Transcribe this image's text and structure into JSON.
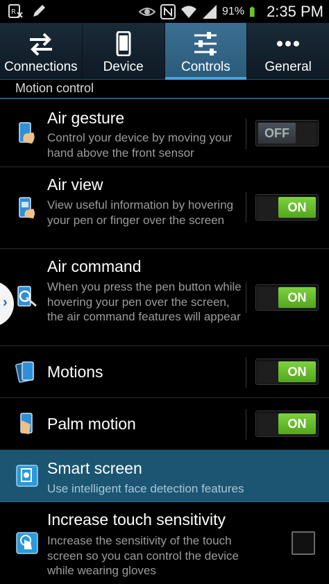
{
  "status_bar": {
    "battery_percent": "91%",
    "time": "2:35 PM",
    "left_icons": [
      "sim-off-icon",
      "pen-icon"
    ],
    "right_icons": [
      "smart-stay-eye-icon",
      "nfc-icon",
      "wifi-icon",
      "signal-icon",
      "battery-icon"
    ]
  },
  "tabs": [
    {
      "label": "Connections",
      "icon": "arrows-swap-icon",
      "active": false
    },
    {
      "label": "Device",
      "icon": "phone-icon",
      "active": false
    },
    {
      "label": "Controls",
      "icon": "sliders-icon",
      "active": true
    },
    {
      "label": "General",
      "icon": "more-dots-icon",
      "active": false
    }
  ],
  "section": {
    "title": "Motion control"
  },
  "rows": [
    {
      "title": "Air gesture",
      "desc": "Control your device by moving your hand above the front sensor",
      "icon": "air-gesture-icon",
      "control": "switch",
      "state": "OFF"
    },
    {
      "title": "Air view",
      "desc": "View useful information by hovering your pen or finger over the screen",
      "icon": "air-view-icon",
      "control": "switch",
      "state": "ON"
    },
    {
      "title": "Air command",
      "desc": "When you press the pen button while hovering your pen over the screen, the air command features will appear",
      "icon": "air-command-icon",
      "control": "switch",
      "state": "ON"
    },
    {
      "title": "Motions",
      "desc": "",
      "icon": "motions-icon",
      "control": "switch",
      "state": "ON"
    },
    {
      "title": "Palm motion",
      "desc": "",
      "icon": "palm-motion-icon",
      "control": "switch",
      "state": "ON"
    },
    {
      "title": "Smart screen",
      "desc": "Use intelligent face detection features",
      "icon": "smart-screen-icon",
      "control": "none",
      "state": ""
    },
    {
      "title": "Increase touch sensitivity",
      "desc": "Increase the sensitivity of the touch screen so you can control the device while wearing gloves",
      "icon": "touch-sensitivity-icon",
      "control": "checkbox",
      "state": "unchecked"
    }
  ],
  "colors": {
    "accent_blue": "#4aa3de",
    "selected_row": "#1b5572",
    "switch_on": "#6cc12e"
  }
}
